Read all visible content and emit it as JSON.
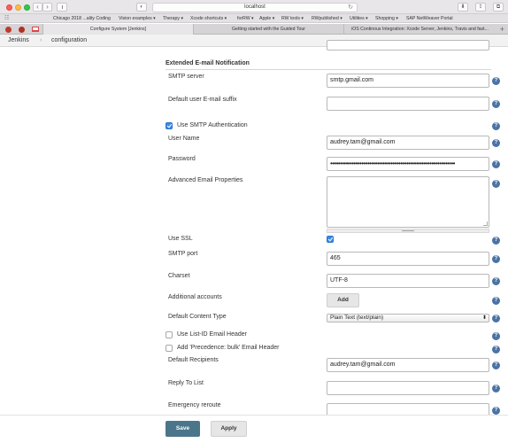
{
  "browser": {
    "url": "localhost",
    "favorites": [
      "Chicago 2018 ...ality Coding",
      "Vision examples ▾",
      "Therapy ▾",
      "Xcode shortcuts ▾",
      "forRW ▾",
      "Apple ▾",
      "RW tools ▾",
      "RWpublished ▾",
      "Utilities ▾",
      "Shopping ▾",
      "SAP NetWeaver Portal"
    ],
    "tabs": [
      "Configure System [Jenkins]",
      "Getting started with the Guided Tour",
      "iOS Continous Integration: Xcode Server, Jenkins, Travis and fast..."
    ]
  },
  "breadcrumb": {
    "items": [
      "Jenkins",
      "configuration"
    ],
    "separator": "›"
  },
  "section": {
    "title": "Extended E-mail Notification"
  },
  "form": {
    "smtp_server_label": "SMTP server",
    "smtp_server_value": "smtp.gmail.com",
    "suffix_label": "Default user E-mail suffix",
    "suffix_value": "",
    "use_smtp_auth_label": "Use SMTP Authentication",
    "use_smtp_auth_checked": true,
    "username_label": "User Name",
    "username_value": "audrey.tam@gmail.com",
    "password_label": "Password",
    "password_value": "••••••••••••••••••••••••••••••••••••••••••••••••••••••••••••••••",
    "advanced_label": "Advanced Email Properties",
    "use_ssl_label": "Use SSL",
    "use_ssl_checked": true,
    "smtp_port_label": "SMTP port",
    "smtp_port_value": "465",
    "charset_label": "Charset",
    "charset_value": "UTF-8",
    "additional_accounts_label": "Additional accounts",
    "add_button_label": "Add",
    "content_type_label": "Default Content Type",
    "content_type_value": "Plain Text (text/plain)",
    "list_id_label": "Use List-ID Email Header",
    "list_id_checked": false,
    "precedence_label": "Add 'Precedence: bulk' Email Header",
    "precedence_checked": false,
    "recipients_label": "Default Recipients",
    "recipients_value": "audrey.tam@gmail.com",
    "reply_to_label": "Reply To List",
    "reply_to_value": "",
    "emergency_label": "Emergency reroute",
    "emergency_value": ""
  },
  "help_glyph": "?",
  "actions": {
    "save_label": "Save",
    "apply_label": "Apply"
  },
  "colors": {
    "save_button": "#4b758b",
    "help_icon": "#4a73a6",
    "checkbox_checked": "#3a8ae8"
  }
}
